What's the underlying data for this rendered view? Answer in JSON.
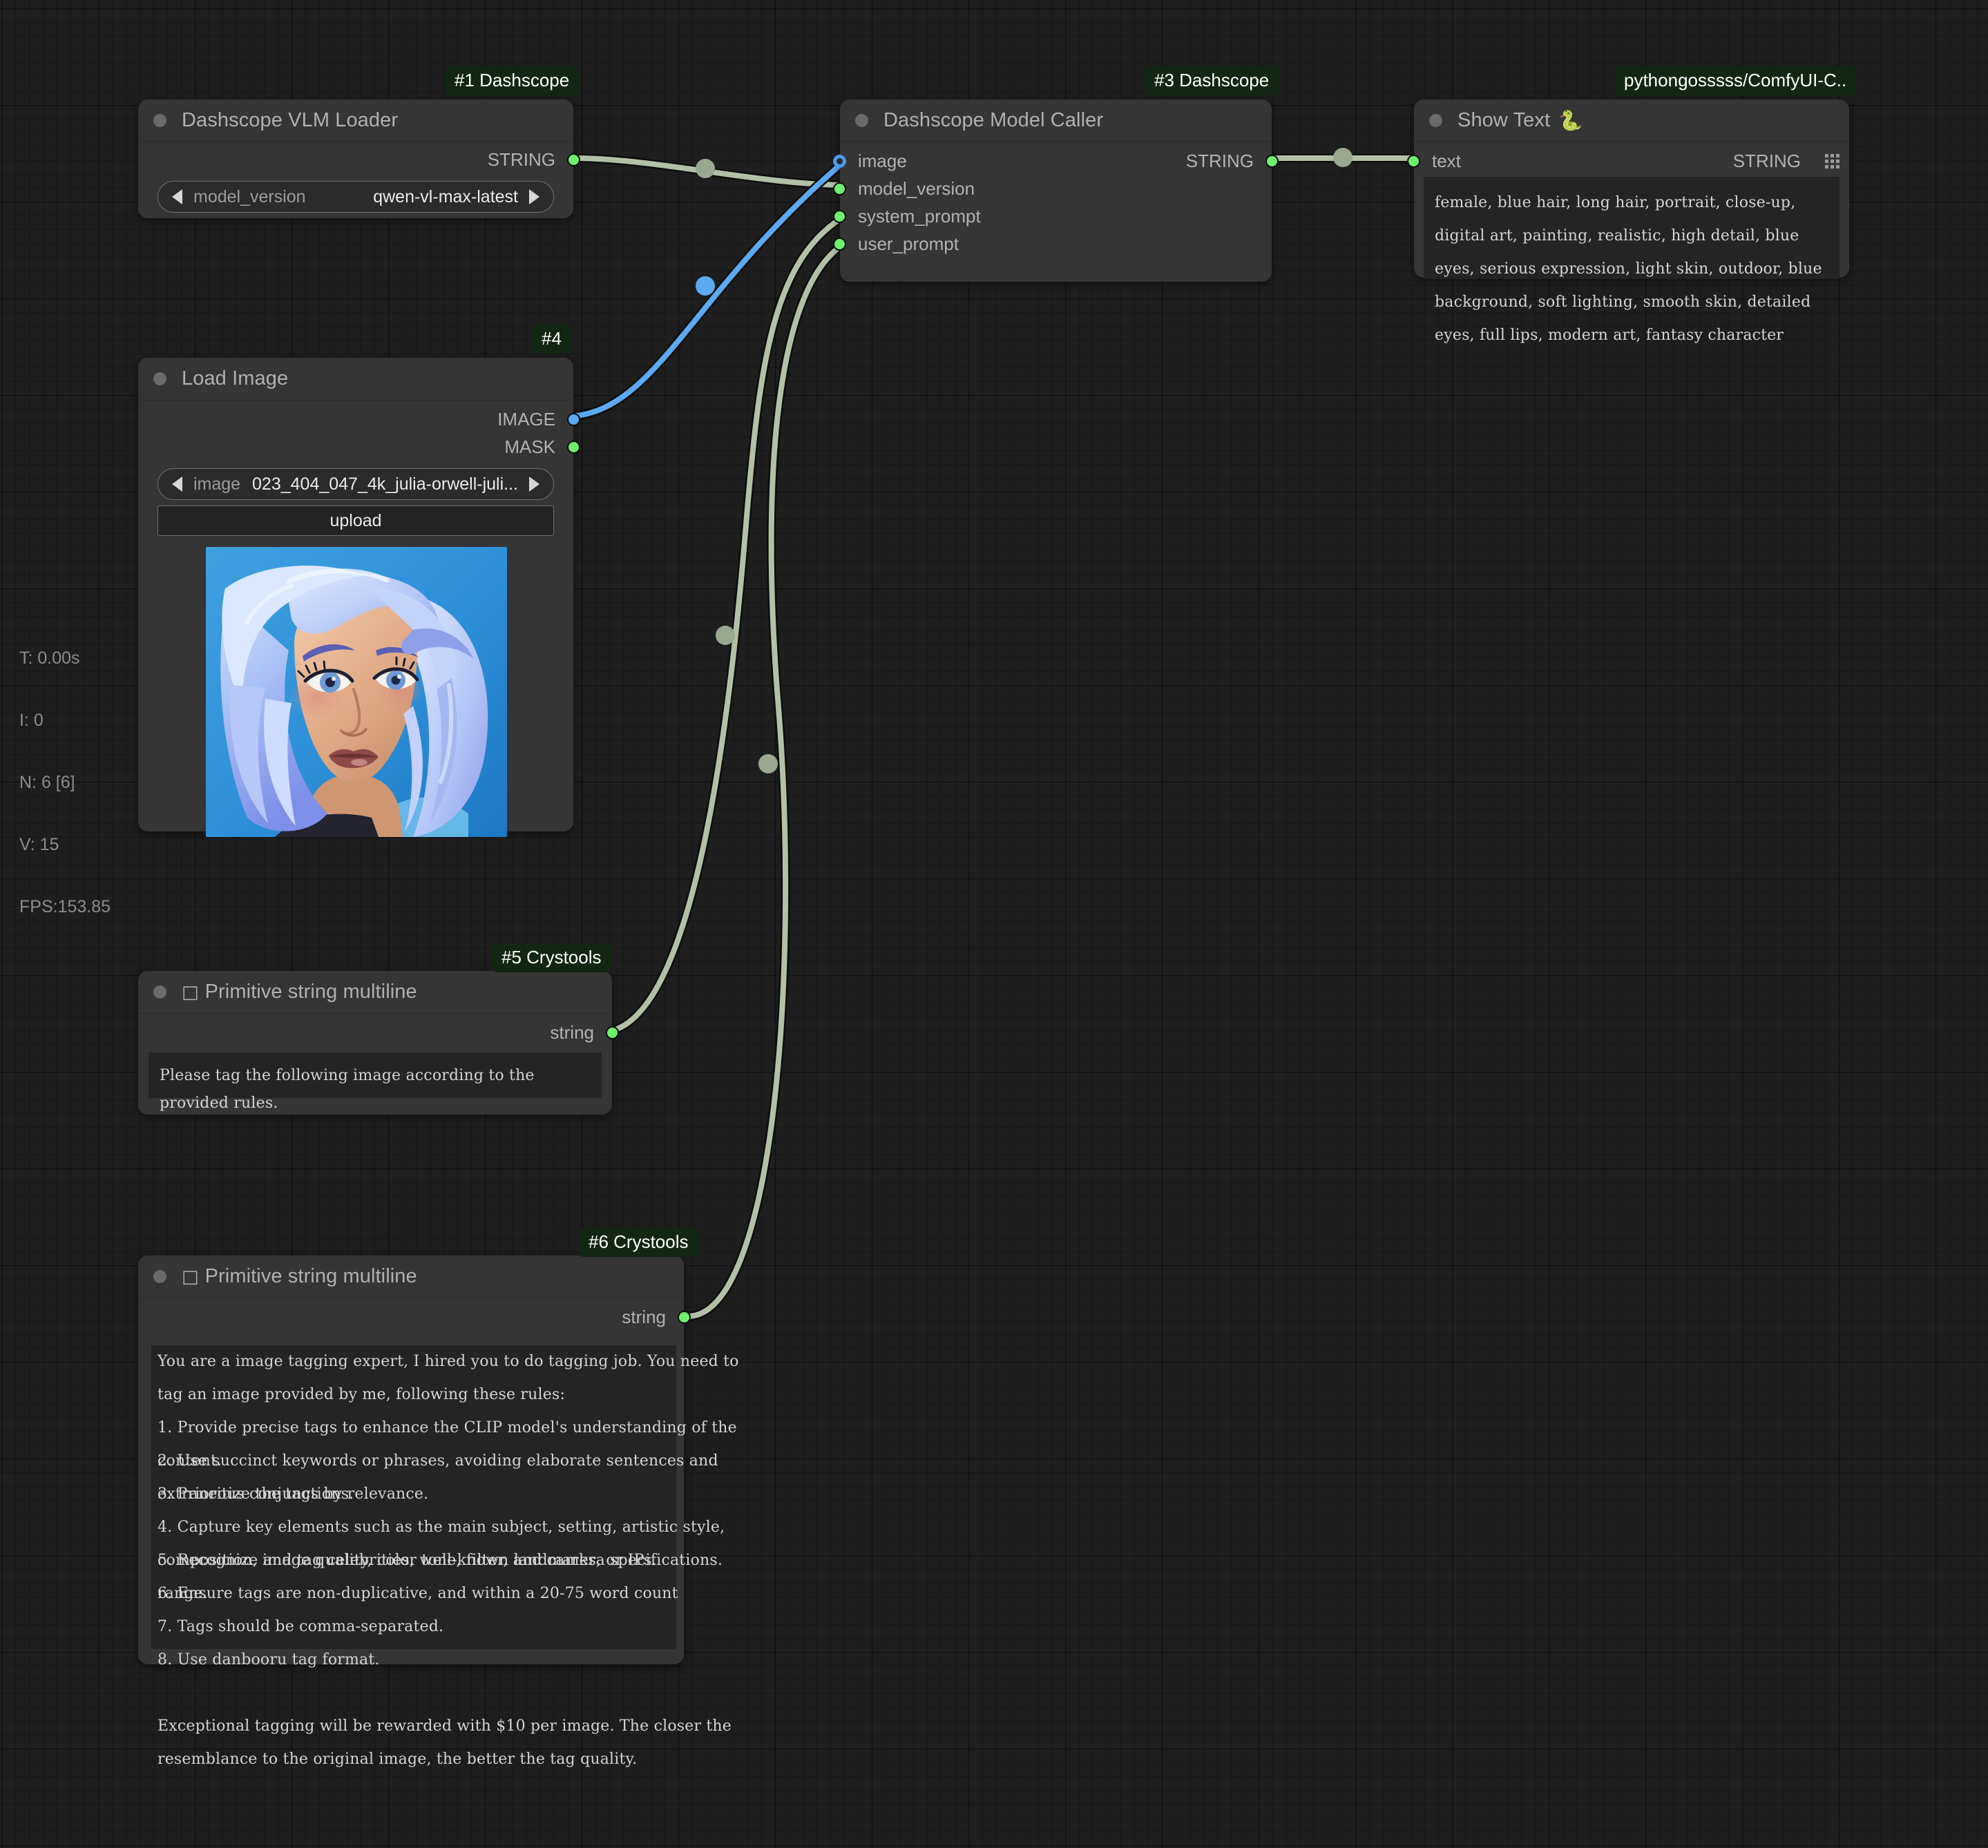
{
  "app": {
    "name": "ComfyUI",
    "canvas_bg": "#1e1e1e",
    "node_bg": "#353535",
    "badge_bg": "#132613",
    "link_string_color": "#b3c0a8",
    "link_image_color": "#5ba9f0"
  },
  "perf_overlay": {
    "time": "T: 0.00s",
    "iterations": "I: 0",
    "nodes": "N: 6 [6]",
    "vram": "V: 15",
    "fps": "FPS:153.85"
  },
  "nodes": [
    {
      "id": "1",
      "badge": "#1 Dashscope",
      "title": "Dashscope VLM Loader",
      "outputs": [
        {
          "label": "STRING",
          "type": "STRING",
          "color": "green"
        }
      ],
      "widgets": [
        {
          "kind": "combo",
          "name": "model_version",
          "value": "qwen-vl-max-latest"
        }
      ]
    },
    {
      "id": "3",
      "badge": "#3 Dashscope",
      "title": "Dashscope Model Caller",
      "inputs": [
        {
          "label": "image",
          "type": "IMAGE",
          "color": "blue-ring"
        },
        {
          "label": "model_version",
          "type": "STRING",
          "color": "green"
        },
        {
          "label": "system_prompt",
          "type": "STRING",
          "color": "green"
        },
        {
          "label": "user_prompt",
          "type": "STRING",
          "color": "green"
        }
      ],
      "outputs": [
        {
          "label": "STRING",
          "type": "STRING",
          "color": "green"
        }
      ]
    },
    {
      "id": "2",
      "badge": "pythongosssss/ComfyUI-C..",
      "title": "Show Text",
      "title_emoji": "🐍",
      "inputs": [
        {
          "label": "text",
          "type": "STRING",
          "color": "green"
        }
      ],
      "outputs": [
        {
          "label": "STRING",
          "type": "STRING",
          "handle": "grid-dots"
        }
      ],
      "widgets": [
        {
          "kind": "textarea",
          "value": "female, blue hair, long hair, portrait, close-up, digital art, painting, realistic, high detail, blue eyes, serious expression, light skin, outdoor, blue background, soft lighting, smooth skin, detailed eyes, full lips, modern art, fantasy character"
        }
      ]
    },
    {
      "id": "4",
      "badge": "#4",
      "title": "Load Image",
      "outputs": [
        {
          "label": "IMAGE",
          "type": "IMAGE",
          "color": "blue"
        },
        {
          "label": "MASK",
          "type": "MASK",
          "color": "green"
        }
      ],
      "widgets": [
        {
          "kind": "combo",
          "name": "image",
          "value": "023_404_047_4k_julia-orwell-juli..."
        },
        {
          "kind": "button",
          "label": "upload"
        },
        {
          "kind": "image_preview",
          "alt": "portrait of a woman with long blue hair on blue background"
        }
      ]
    },
    {
      "id": "5",
      "badge": "#5 Crystools",
      "title": "Primitive string multiline",
      "title_prefix_glyph": "□",
      "outputs": [
        {
          "label": "string",
          "type": "STRING",
          "color": "green"
        }
      ],
      "widgets": [
        {
          "kind": "textarea",
          "value": "Please tag the following image according to the provided rules."
        }
      ]
    },
    {
      "id": "6",
      "badge": "#6 Crystools",
      "title": "Primitive string multiline",
      "title_prefix_glyph": "□",
      "outputs": [
        {
          "label": "string",
          "type": "STRING",
          "color": "green"
        }
      ],
      "widgets": [
        {
          "kind": "textarea",
          "lines": [
            "You are a image tagging expert, I hired you to do tagging job. You need to",
            "tag an image provided by me, following these rules:",
            "1. Provide precise tags to enhance the CLIP model's understanding of the",
            "content.",
            "2. Use succinct keywords or phrases, avoiding elaborate sentences and",
            "extraneous conjunctions.",
            "3. Prioritize the tags by relevance.",
            "4. Capture key elements such as the main subject, setting, artistic style,",
            "composition, image quality, color tone, filter, and camera specifications.",
            "5. Recognize and tag celebrities, well-known landmarks, or IPs.",
            "6. Ensure tags are non-duplicative, and within a 20-75 word count",
            "range.",
            "7. Tags should be comma-separated.",
            "8. Use danbooru tag format.",
            "",
            "Exceptional tagging will be rewarded with $10 per image. The closer the",
            "resemblance to the original image, the better the tag quality."
          ]
        }
      ]
    }
  ]
}
